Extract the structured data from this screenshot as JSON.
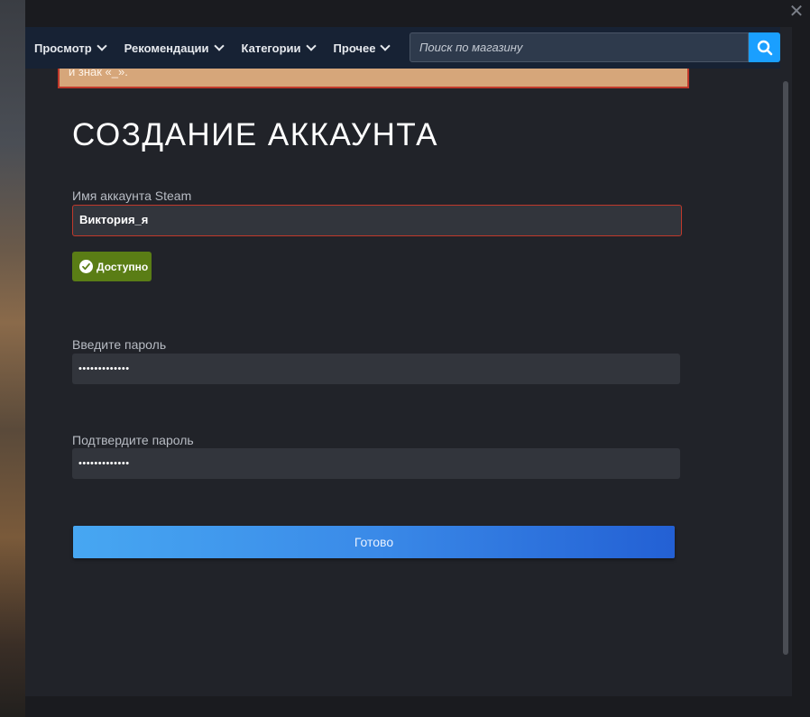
{
  "nav": {
    "items": [
      {
        "label": "Просмотр"
      },
      {
        "label": "Рекомендации"
      },
      {
        "label": "Категории"
      },
      {
        "label": "Прочее"
      }
    ],
    "search_placeholder": "Поиск по магазину"
  },
  "banner": {
    "text": "и знак «_»."
  },
  "form": {
    "title": "СОЗДАНИЕ АККАУНТА",
    "username_label": "Имя аккаунта Steam",
    "username_value": "Виктория_я",
    "availability": "Доступно",
    "password_label": "Введите пароль",
    "password_value": "•••••••••••••",
    "confirm_label": "Подтвердите пароль",
    "confirm_value": "•••••••••••••",
    "submit_label": "Готово"
  },
  "colors": {
    "accent": "#1a9fff",
    "error_border": "#c0392b",
    "available_badge": "#5a7d15",
    "banner": "#d6a67a"
  }
}
